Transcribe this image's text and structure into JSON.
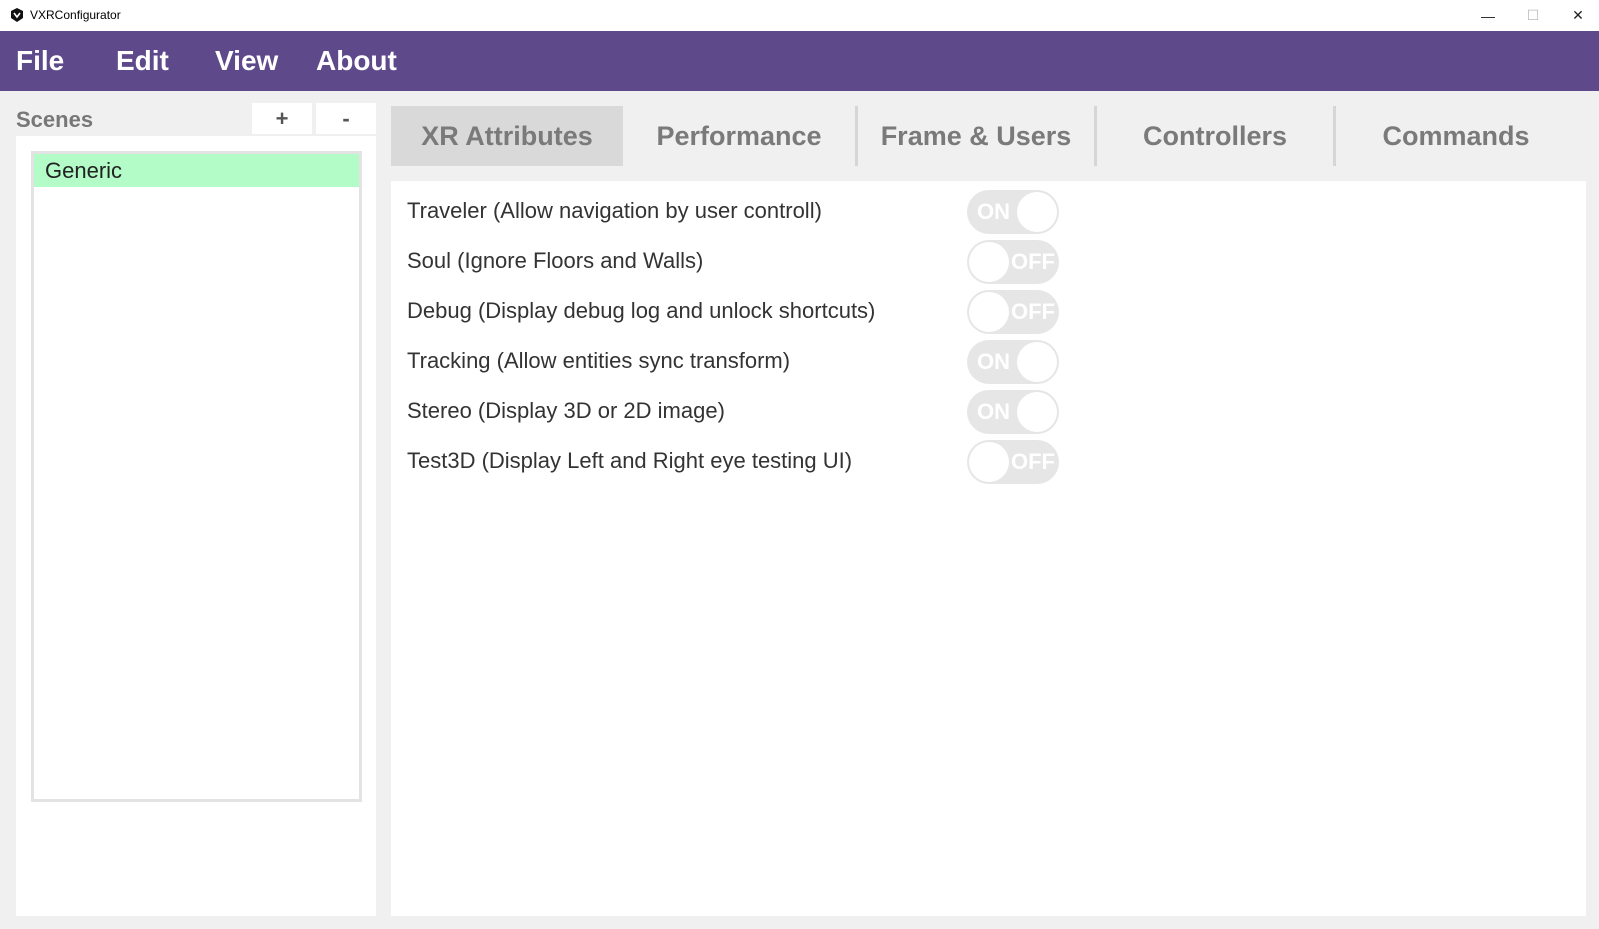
{
  "window": {
    "title": "VXRConfigurator",
    "minimize_glyph": "—",
    "maximize_glyph": "☐",
    "close_glyph": "✕"
  },
  "menu": {
    "file": "File",
    "edit": "Edit",
    "view": "View",
    "about": "About"
  },
  "scenes": {
    "title": "Scenes",
    "add_label": "+",
    "remove_label": "-",
    "items": [
      {
        "label": "Generic",
        "selected": true
      }
    ]
  },
  "tabs": [
    {
      "label": "XR Attributes",
      "active": true
    },
    {
      "label": "Performance",
      "active": false
    },
    {
      "label": "Frame & Users",
      "active": false
    },
    {
      "label": "Controllers",
      "active": false
    },
    {
      "label": "Commands",
      "active": false
    }
  ],
  "attributes": [
    {
      "label": "Traveler (Allow navigation by user controll)",
      "state": "ON"
    },
    {
      "label": "Soul (Ignore Floors and Walls)",
      "state": "OFF"
    },
    {
      "label": "Debug (Display debug log and unlock shortcuts)",
      "state": "OFF"
    },
    {
      "label": "Tracking (Allow entities sync transform)",
      "state": "ON"
    },
    {
      "label": "Stereo (Display 3D or 2D image)",
      "state": "ON"
    },
    {
      "label": "Test3D (Display Left and Right eye testing UI)",
      "state": "OFF"
    }
  ],
  "colors": {
    "menu_bar": "#5e4a8b",
    "selected_scene": "#b3fbc7",
    "active_tab": "#d9d9d9"
  }
}
